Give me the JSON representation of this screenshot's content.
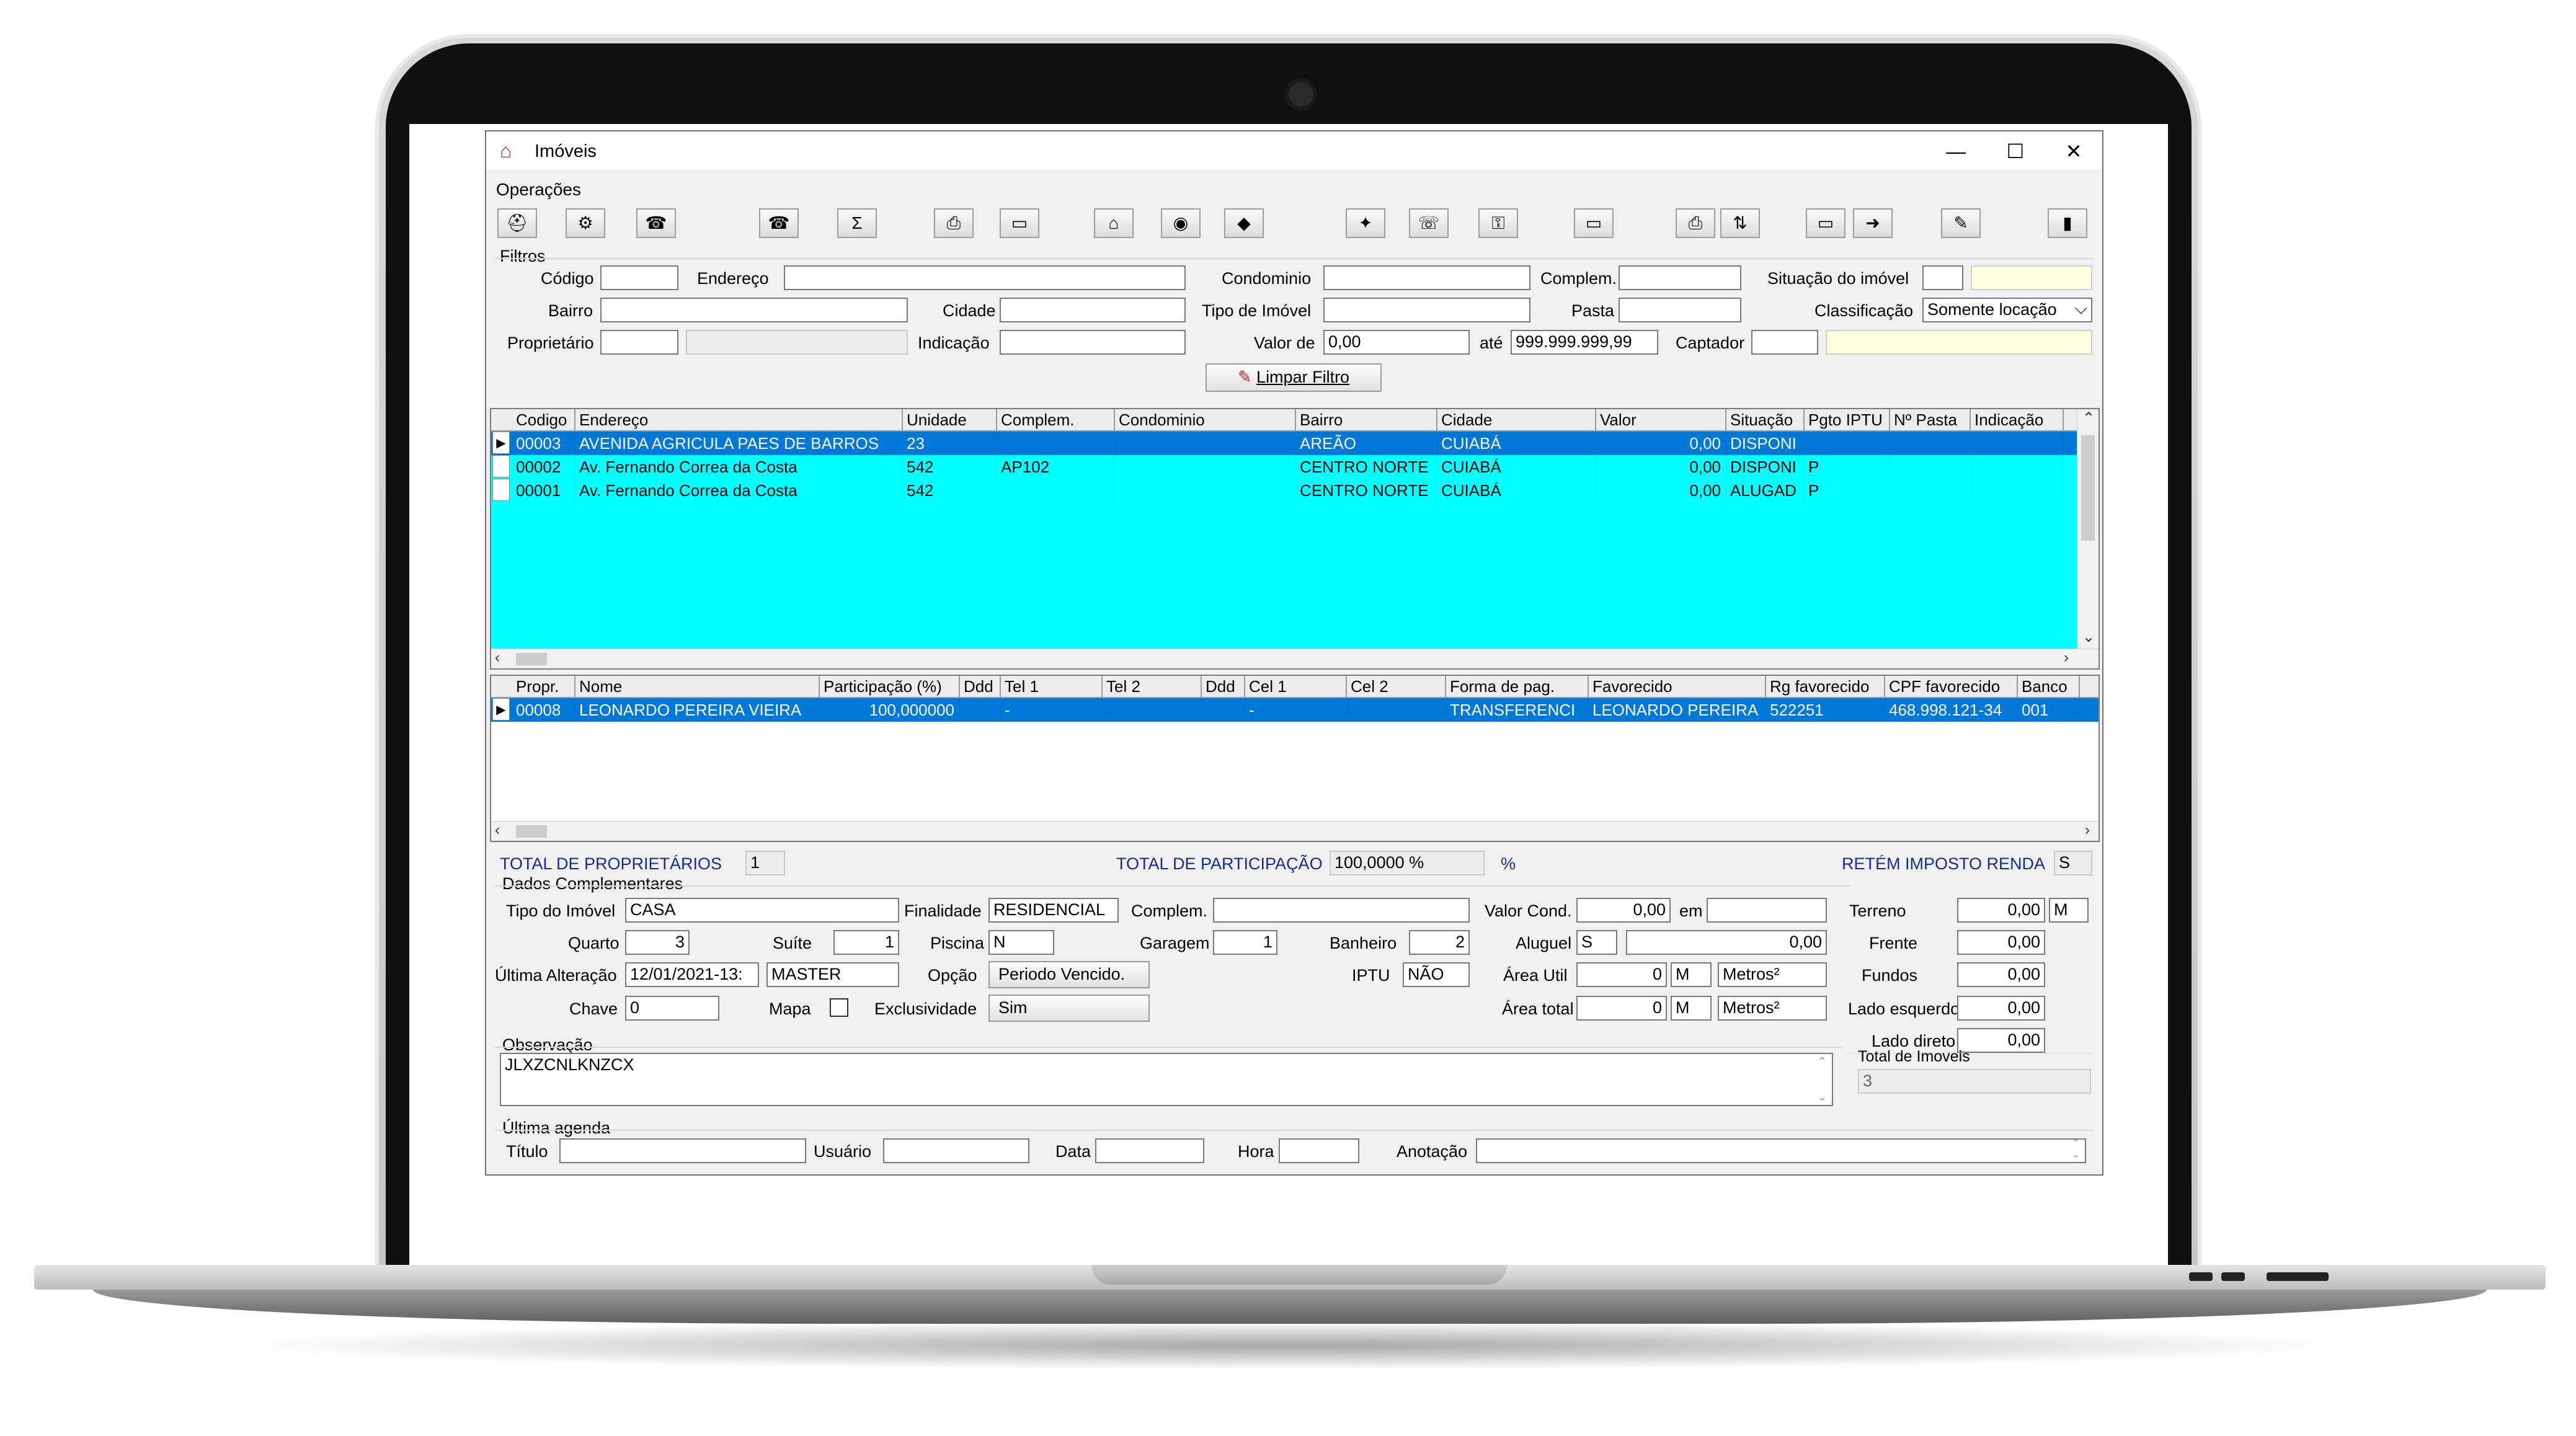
{
  "window": {
    "title": "Imóveis",
    "menu": "Operações"
  },
  "toolbar": {
    "buttons": [
      {
        "name": "toolbar-button-1-icon",
        "glyph": "⛑"
      },
      {
        "name": "toolbar-button-2-icon",
        "glyph": "⚙"
      },
      {
        "name": "toolbar-button-3-icon",
        "glyph": "☎"
      },
      {
        "name": "toolbar-button-4-icon",
        "glyph": "☎"
      },
      {
        "name": "toolbar-button-sum-icon",
        "glyph": "Σ"
      },
      {
        "name": "toolbar-button-print-icon",
        "glyph": "⎙"
      },
      {
        "name": "toolbar-button-7-icon",
        "glyph": "▭"
      },
      {
        "name": "toolbar-button-house-icon",
        "glyph": "⌂"
      },
      {
        "name": "toolbar-button-9-icon",
        "glyph": "◉"
      },
      {
        "name": "toolbar-button-10-icon",
        "glyph": "◆"
      },
      {
        "name": "toolbar-button-11-icon",
        "glyph": "✦"
      },
      {
        "name": "toolbar-button-12-icon",
        "glyph": "☏"
      },
      {
        "name": "toolbar-button-key-icon",
        "glyph": "⚿"
      },
      {
        "name": "toolbar-button-14-icon",
        "glyph": "▭"
      },
      {
        "name": "toolbar-button-15-icon",
        "glyph": "⎙"
      },
      {
        "name": "toolbar-button-16-icon",
        "glyph": "⇅"
      },
      {
        "name": "toolbar-button-17-icon",
        "glyph": "▭"
      },
      {
        "name": "toolbar-button-arrow-icon",
        "glyph": "➜"
      },
      {
        "name": "toolbar-button-19-icon",
        "glyph": "✎"
      },
      {
        "name": "toolbar-button-exit-icon",
        "glyph": "▮"
      }
    ]
  },
  "filters": {
    "group": "Filtros",
    "codigo": "Código",
    "endereco": "Endereço",
    "condominio": "Condominio",
    "complem": "Complem.",
    "situacao": "Situação do imóvel",
    "bairro": "Bairro",
    "cidade": "Cidade",
    "tipo_imovel": "Tipo de Imóvel",
    "pasta": "Pasta",
    "classificacao": "Classificação",
    "classificacao_value": "Somente locação",
    "proprietario": "Proprietário",
    "indicacao": "Indicação",
    "valor_de": "Valor de",
    "valor_de_value": "0,00",
    "ate": "até",
    "ate_value": "999.999.999,99",
    "captador": "Captador",
    "limpar": "Limpar Filtro"
  },
  "imoveis_grid": {
    "columns": [
      "Codigo",
      "Endereço",
      "Unidade",
      "Complem.",
      "Condominio",
      "Bairro",
      "Cidade",
      "Valor",
      "Situação",
      "Pgto IPTU",
      "Nº Pasta",
      "Indicação"
    ],
    "rows": [
      [
        "00003",
        "AVENIDA AGRICULA PAES DE BARROS",
        "23",
        "",
        "",
        "AREÃO",
        "CUIABÁ",
        "0,00",
        "DISPONI",
        "",
        "",
        ""
      ],
      [
        "00002",
        "Av. Fernando Correa da Costa",
        "542",
        "AP102",
        "",
        "CENTRO NORTE",
        "CUIABÁ",
        "0,00",
        "DISPONI",
        "P",
        "",
        ""
      ],
      [
        "00001",
        "Av. Fernando Correa da Costa",
        "542",
        "",
        "",
        "CENTRO NORTE",
        "CUIABÁ",
        "0,00",
        "ALUGAD",
        "P",
        "",
        ""
      ]
    ]
  },
  "proprietarios_grid": {
    "columns": [
      "Propr.",
      "Nome",
      "Participação (%)",
      "Ddd",
      "Tel 1",
      "Tel 2",
      "Ddd",
      "Cel 1",
      "Cel 2",
      "Forma de pag.",
      "Favorecido",
      "Rg favorecido",
      "CPF favorecido",
      "Banco"
    ],
    "rows": [
      [
        "00008",
        "LEONARDO PEREIRA VIEIRA",
        "100,000000",
        "",
        "-",
        "",
        "",
        "-",
        "",
        "TRANSFERENCI",
        "LEONARDO PEREIRA",
        "522251",
        "468.998.121-34",
        "001"
      ]
    ]
  },
  "totals": {
    "total_proprietarios": "TOTAL DE PROPRIETÁRIOS",
    "total_proprietarios_value": "1",
    "total_participacao": "TOTAL DE PARTICIPAÇÃO",
    "total_participacao_value": "100,0000 %",
    "pct": "%",
    "retem": "RETÉM IMPOSTO RENDA",
    "retem_value": "S"
  },
  "dados": {
    "group": "Dados Complementares",
    "tipo_imovel": "Tipo do Imóvel",
    "tipo_imovel_value": "CASA",
    "finalidade": "Finalidade",
    "finalidade_value": "RESIDENCIAL",
    "complem": "Complem.",
    "valor_cond": "Valor Cond.",
    "valor_cond_value": "0,00",
    "em": "em",
    "quarto": "Quarto",
    "quarto_value": "3",
    "suite": "Suíte",
    "suite_value": "1",
    "piscina": "Piscina",
    "piscina_value": "N",
    "garagem": "Garagem",
    "garagem_value": "1",
    "banheiro": "Banheiro",
    "banheiro_value": "2",
    "aluguel": "Aluguel",
    "aluguel_flag": "S",
    "aluguel_value": "0,00",
    "ultima_alteracao": "Última Alteração",
    "ultima_alteracao_value": "12/01/2021-13:",
    "usuario_value": "MASTER",
    "opcao": "Opção",
    "opcao_value": "Periodo Vencido.",
    "iptu": "IPTU",
    "iptu_value": "NÃO",
    "area_util": "Área Util",
    "area_util_value": "0",
    "area_util_unit": "M",
    "area_util_measure": "Metros²",
    "chave": "Chave",
    "chave_value": "0",
    "mapa": "Mapa",
    "exclusividade": "Exclusividade",
    "exclusividade_value": "Sim",
    "area_total": "Área total",
    "area_total_value": "0",
    "area_total_unit": "M",
    "area_total_measure": "Metros²",
    "terreno": "Terreno",
    "terreno_value": "0,00",
    "terreno_unit": "M",
    "frente": "Frente",
    "frente_value": "0,00",
    "fundos": "Fundos",
    "fundos_value": "0,00",
    "lado_esquerdo": "Lado esquerdo",
    "lado_esquerdo_value": "0,00",
    "lado_direito": "Lado direto",
    "lado_direito_value": "0,00",
    "total_imoveis": "Total de Imoveis",
    "total_imoveis_value": "3"
  },
  "observacao": {
    "label": "Observação",
    "value": "JLXZCNLKNZCX"
  },
  "agenda": {
    "group": "Última agenda",
    "titulo": "Título",
    "usuario": "Usuário",
    "data": "Data",
    "hora": "Hora",
    "anotacao": "Anotação"
  }
}
